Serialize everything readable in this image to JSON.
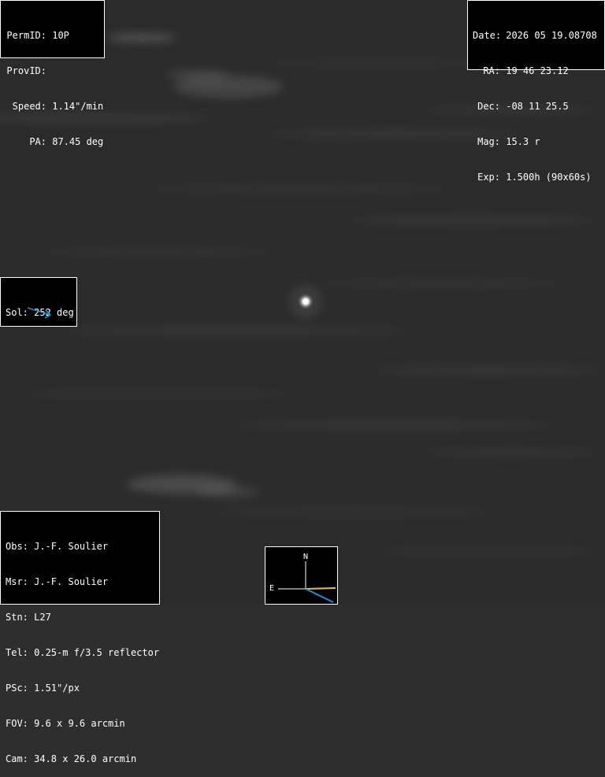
{
  "object_info": {
    "permid_label": "PermID:",
    "permid_value": "10P",
    "provid_label": "ProvID:",
    "provid_value": "",
    "speed_label": "Speed:",
    "speed_value": "1.14\"/min",
    "pa_label": "PA:",
    "pa_value": "87.45 deg"
  },
  "observation": {
    "date_label": "Date:",
    "date_value": "2026 05 19.08708",
    "ra_label": "RA:",
    "ra_value": "19 46 23.12",
    "dec_label": "Dec:",
    "dec_value": "-08 11 25.5",
    "mag_label": "Mag:",
    "mag_value": "15.3 r",
    "exp_label": "Exp:",
    "exp_value": "1.500h (90x60s)"
  },
  "solar": {
    "label": "Sol:",
    "value": "252 deg",
    "arrow_color": "#1e90d6"
  },
  "observer": {
    "obs": "Obs: J.-F. Soulier",
    "msr": "Msr: J.-F. Soulier",
    "stn": "Stn: L27",
    "tel": "Tel: 0.25-m f/3.5 reflector",
    "psc": "PSc: 1.51\"/px",
    "fov": "FOV: 9.6 x 9.6 arcmin",
    "cam": "Cam: 34.8 x 26.0 arcmin"
  },
  "compass": {
    "north": "N",
    "east": "E",
    "motion_color": "#f0c040",
    "sun_color": "#1e90d6"
  },
  "colors": {
    "sky": "#2e2e2e",
    "box_bg": "#000000",
    "text": "#ffffff"
  }
}
